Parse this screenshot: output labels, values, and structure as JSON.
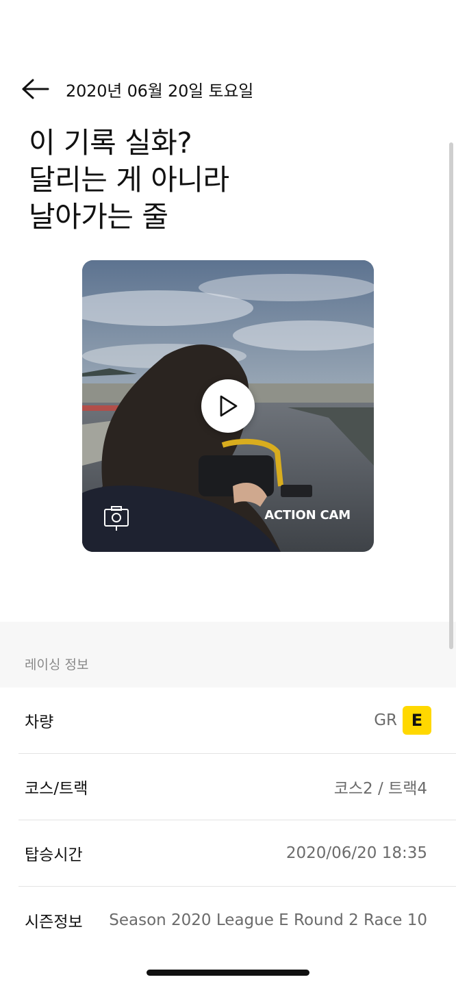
{
  "header": {
    "back_icon": "arrow-left-icon",
    "date": "2020년 06월 20일 토요일"
  },
  "headline": {
    "lines": [
      "이 기록 실화?",
      "달리는 게 아니라",
      "날아가는 줄"
    ]
  },
  "video": {
    "play_icon": "play-icon",
    "camera_icon": "camera-switch-icon",
    "label": "ACTION CAM"
  },
  "racing_info": {
    "section_label": "레이싱 정보",
    "rows": [
      {
        "key": "차량",
        "value": "GR",
        "badge": "E"
      },
      {
        "key": "코스/트랙",
        "value": "코스2 / 트랙4"
      },
      {
        "key": "탑승시간",
        "value": "2020/06/20 18:35"
      },
      {
        "key": "시즌정보",
        "value": "Season 2020 League E Round 2 Race 10"
      }
    ]
  },
  "colors": {
    "badge": "#ffd800",
    "background": "#ffffff",
    "section_band": "#f7f7f7"
  }
}
